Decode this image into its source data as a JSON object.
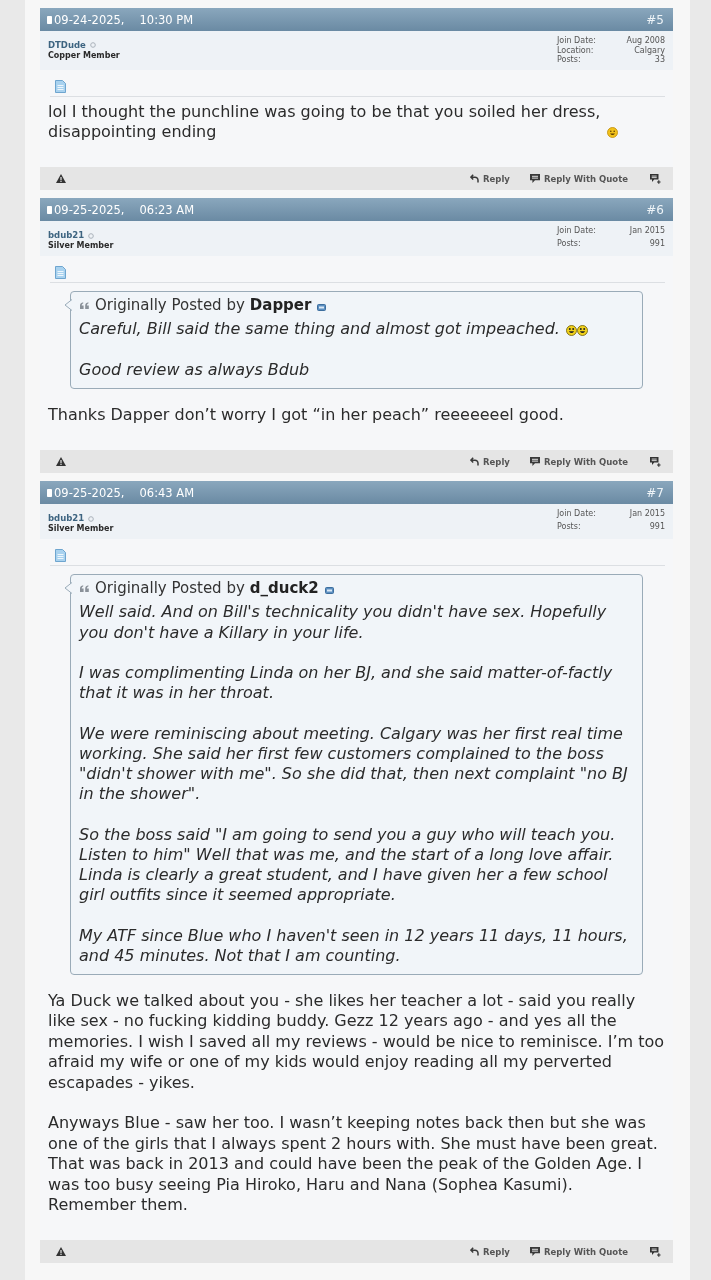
{
  "posts": [
    {
      "date": "09-24-2025,",
      "time": "10:30 PM",
      "number": "#5",
      "user": {
        "name": "DTDude",
        "online": false,
        "title": "Copper Member"
      },
      "stats": [
        {
          "label": "Join Date:",
          "value": "Aug 2008"
        },
        {
          "label": "Location:",
          "value": "Calgary"
        },
        {
          "label": "Posts:",
          "value": "33"
        }
      ],
      "paragraphs": [
        {
          "kind": "grin",
          "text": "lol I thought the punchline was going to be that you soiled her dress, disappointing ending"
        }
      ],
      "actions": [
        {
          "kind": "reply",
          "label": "Reply"
        },
        {
          "kind": "quote",
          "label": "Reply With Quote"
        }
      ]
    },
    {
      "date": "09-25-2025,",
      "time": "06:23 AM",
      "number": "#6",
      "user": {
        "name": "bdub21",
        "online": false,
        "title": "Silver Member"
      },
      "stats": [
        {
          "label": "Join Date:",
          "value": "Jan 2015"
        },
        {
          "label": "Posts:",
          "value": "991"
        }
      ],
      "quote": {
        "prefix": "Originally Posted by",
        "author": "Dapper",
        "paragraphs": [
          {
            "kind": "laughing",
            "text": "Careful, Bill said the same thing and almost got impeached."
          },
          {
            "kind": "plain",
            "text": "Good review as always Bdub"
          }
        ]
      },
      "paragraphs": [
        {
          "kind": "plain",
          "text": "Thanks Dapper don’t worry I got “in her peach” reeeeeeel good."
        }
      ],
      "actions": [
        {
          "kind": "reply",
          "label": "Reply"
        },
        {
          "kind": "quote",
          "label": "Reply With Quote"
        }
      ]
    },
    {
      "date": "09-25-2025,",
      "time": "06:43 AM",
      "number": "#7",
      "user": {
        "name": "bdub21",
        "online": false,
        "title": "Silver Member"
      },
      "stats": [
        {
          "label": "Join Date:",
          "value": "Jan 2015"
        },
        {
          "label": "Posts:",
          "value": "991"
        }
      ],
      "quote": {
        "prefix": "Originally Posted by",
        "author": "d_duck2",
        "paragraphs": [
          {
            "kind": "plain",
            "text": "Well said. And on Bill's technicality you didn't have sex. Hopefully you don't have a Killary in your life."
          },
          {
            "kind": "plain",
            "text": "I was complimenting Linda on her BJ, and she said matter-of-factly that it was in her throat."
          },
          {
            "kind": "plain",
            "text": "We were reminiscing about meeting. Calgary was her first real time working. She said her first few customers complained to the boss \"didn't shower with me\". So she did that, then next complaint \"no BJ in the shower\"."
          },
          {
            "kind": "plain",
            "text": "So the boss said \"I am going to send you a guy who will teach you. Listen to him\" Well that was me, and the start of a long love affair. Linda is clearly a great student, and I have given her a few school girl outfits since it seemed appropriate."
          },
          {
            "kind": "plain",
            "text": "My ATF since Blue who I haven't seen in 12 years 11 days, 11 hours, and 45 minutes. Not that I am counting."
          }
        ]
      },
      "paragraphs": [
        {
          "kind": "plain",
          "text": "Ya Duck we talked about you - she likes her teacher a lot - said you really like sex - no fucking kidding buddy. Gezz 12 years ago - and yes all the memories. I wish I saved all my reviews - would be nice to reminisce. I’m too afraid my wife or one of my kids would enjoy reading all my perverted escapades - yikes."
        },
        {
          "kind": "plain",
          "text": "Anyways Blue - saw her too. I wasn’t keeping notes back then but she was one of the girls that I always spent 2 hours with. She must have been great. That was back in 2013 and could have been the peak of the Golden Age. I was too busy seeing Pia Hiroko, Haru and Nana (Sophea Kasumi). Remember them."
        }
      ],
      "actions": [
        {
          "kind": "reply",
          "label": "Reply"
        },
        {
          "kind": "quote",
          "label": "Reply With Quote"
        }
      ]
    }
  ]
}
